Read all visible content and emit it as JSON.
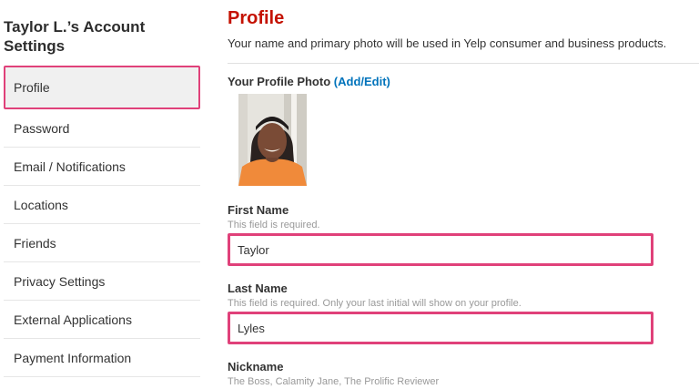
{
  "sidebar": {
    "title": "Taylor L.’s Account Settings",
    "items": [
      {
        "label": "Profile",
        "active": true
      },
      {
        "label": "Password"
      },
      {
        "label": "Email / Notifications"
      },
      {
        "label": "Locations"
      },
      {
        "label": "Friends"
      },
      {
        "label": "Privacy Settings"
      },
      {
        "label": "External Applications"
      },
      {
        "label": "Payment Information"
      }
    ]
  },
  "main": {
    "title": "Profile",
    "description": "Your name and primary photo will be used in Yelp consumer and business products.",
    "photo_label": "Your Profile Photo",
    "photo_link": "(Add/Edit)",
    "first_name": {
      "label": "First Name",
      "help": "This field is required.",
      "value": "Taylor"
    },
    "last_name": {
      "label": "Last Name",
      "help": "This field is required. Only your last initial will show on your profile.",
      "value": "Lyles"
    },
    "nickname": {
      "label": "Nickname",
      "placeholder": "The Boss, Calamity Jane, The Prolific Reviewer"
    }
  },
  "colors": {
    "accent": "#c41200",
    "highlight": "#e0417a",
    "link": "#0073bb"
  }
}
